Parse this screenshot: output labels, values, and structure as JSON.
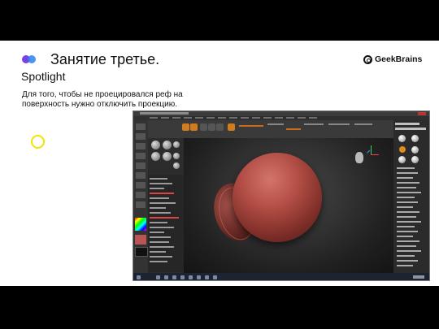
{
  "slide": {
    "title": "Занятие третье.",
    "subtitle": "Spotlight",
    "description": "Для того, чтобы не проецировался реф на поверхность нужно отключить проекцию.",
    "brand": "GeekBrains",
    "bullet_colors": [
      "#7b3fe4",
      "#2f80ed"
    ],
    "highlight_color": "#f2e400"
  },
  "screenshot": {
    "app": "ZBrush",
    "subject": "sphere",
    "subject_color": "#b24e45"
  }
}
